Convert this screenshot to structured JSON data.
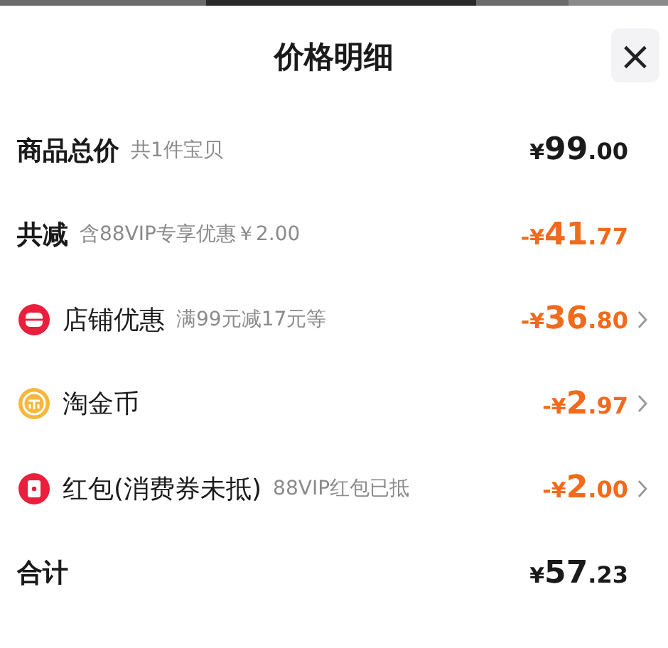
{
  "sheet": {
    "title": "价格明细",
    "close": "×"
  },
  "rows": [
    {
      "kind": "plain",
      "label": "商品总价",
      "note": "共1件宝贝",
      "amount": {
        "currency": "¥",
        "integer": "99",
        "decimal": ".00"
      },
      "highlight": false,
      "chevron": false
    },
    {
      "kind": "plain",
      "label": "共减",
      "note": "含88VIP专享优惠￥2.00",
      "amount": {
        "currency": "-¥",
        "integer": "41",
        "decimal": ".77"
      },
      "highlight": true,
      "chevron": false
    },
    {
      "kind": "shop",
      "label": "店铺优惠",
      "note": "满99元减17元等",
      "amount": {
        "currency": "-¥",
        "integer": "36",
        "decimal": ".80"
      },
      "highlight": true,
      "chevron": true
    },
    {
      "kind": "coin",
      "label": "淘金币",
      "amount": {
        "currency": "-¥",
        "integer": "2",
        "decimal": ".97"
      },
      "highlight": true,
      "chevron": true
    },
    {
      "kind": "redpacket",
      "label": "红包(消费券未抵)",
      "note": "88VIP红包已抵",
      "amount": {
        "currency": "-¥",
        "integer": "2",
        "decimal": ".00"
      },
      "highlight": true,
      "chevron": true
    },
    {
      "kind": "plain",
      "label": "合计",
      "amount": {
        "currency": "¥",
        "integer": "57",
        "decimal": ".23"
      },
      "highlight": false,
      "chevron": false
    }
  ]
}
